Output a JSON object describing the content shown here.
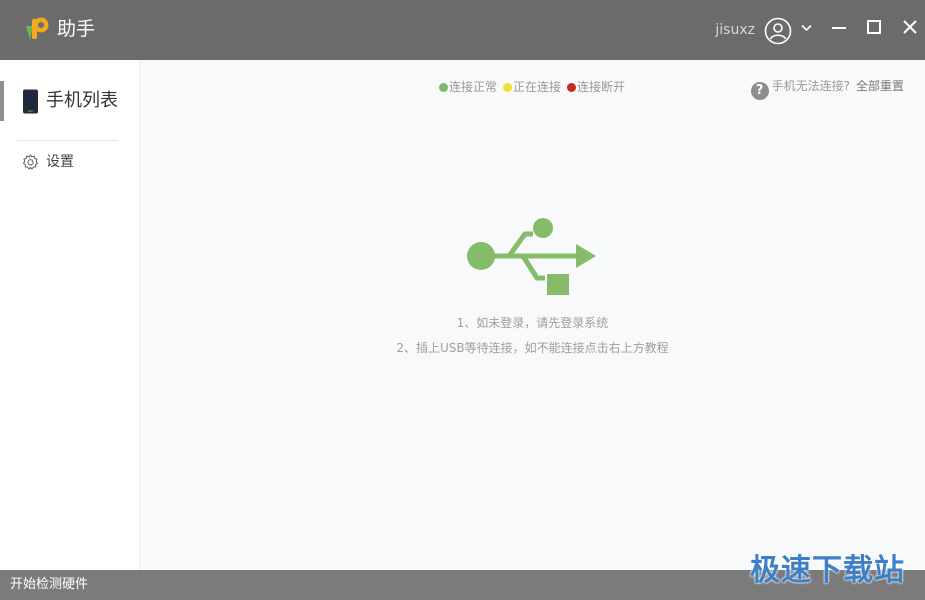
{
  "titlebar": {
    "app_title": "助手",
    "username": "jisuxz",
    "colors": {
      "background": "#6b6b6b",
      "text": "#ffffff"
    },
    "icons": [
      "app-logo-icon",
      "user-avatar-icon",
      "chevron-down-icon",
      "minimize-icon",
      "maximize-icon",
      "close-icon"
    ]
  },
  "sidebar": {
    "items": [
      {
        "label": "手机列表",
        "icon": "phone-icon",
        "active": true
      },
      {
        "label": "设置",
        "icon": "gear-icon",
        "active": false
      }
    ]
  },
  "legend": {
    "items": [
      {
        "label": "连接正常",
        "color": "#7dbb6a"
      },
      {
        "label": "正在连接",
        "color": "#f0e130"
      },
      {
        "label": "连接断开",
        "color": "#c8281e"
      }
    ]
  },
  "help": {
    "icon": "help-circle-icon",
    "text": "手机无法连接?",
    "reset": "全部重置"
  },
  "main": {
    "graphic_icon": "usb-icon",
    "graphic_color": "#86bb6a",
    "instructions": [
      "1、如未登录，请先登录系统",
      "2、插上USB等待连接，如不能连接点击右上方教程"
    ]
  },
  "statusbar": {
    "text": "开始检测硬件"
  },
  "watermark": "极速下载站"
}
